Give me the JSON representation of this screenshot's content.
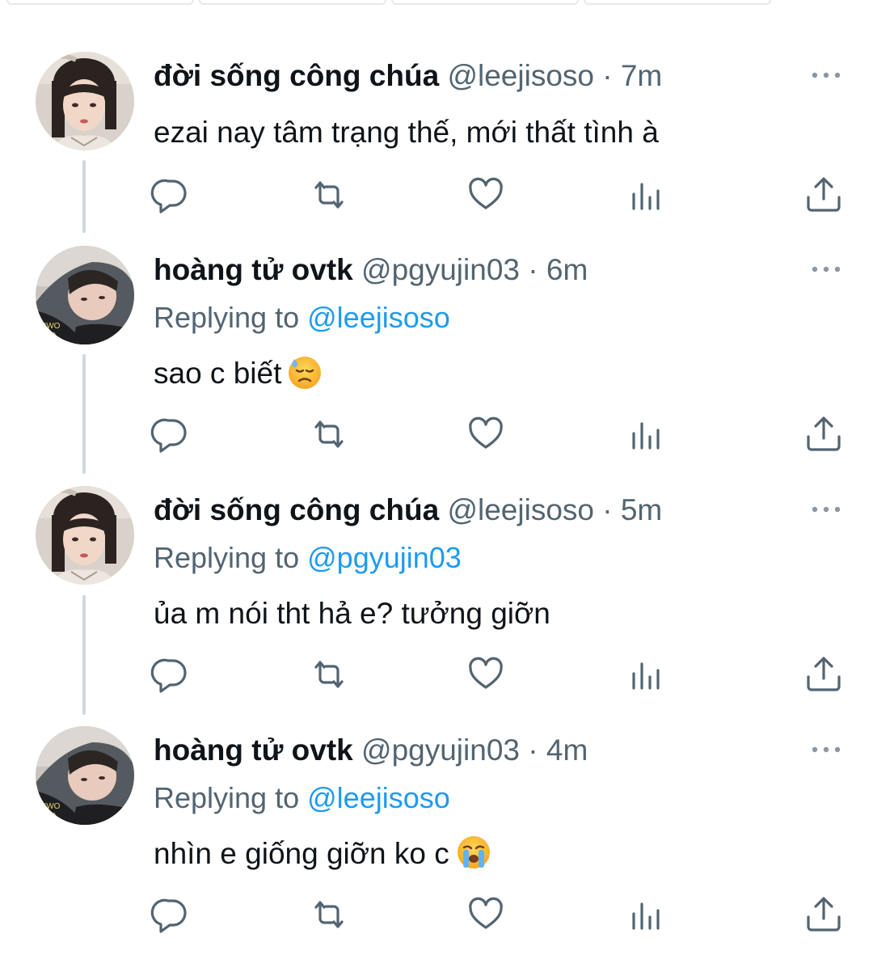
{
  "tweets": [
    {
      "name": "đời sống công chúa",
      "handle": "@leejisoso",
      "separator": "·",
      "time": "7m",
      "replying_label": "",
      "replying_to": "",
      "text": "ezai nay tâm trạng thế, mới thất tình à",
      "emoji": ""
    },
    {
      "name": "hoàng tử ovtk",
      "handle": "@pgyujin03",
      "separator": "·",
      "time": "6m",
      "replying_label": "Replying to",
      "replying_to": "@leejisoso",
      "text": "sao c biết",
      "emoji": "sweat-sad-face"
    },
    {
      "name": "đời sống công chúa",
      "handle": "@leejisoso",
      "separator": "·",
      "time": "5m",
      "replying_label": "Replying to",
      "replying_to": "@pgyujin03",
      "text": "ủa m nói tht hả e? tưởng giỡn",
      "emoji": ""
    },
    {
      "name": "hoàng tử ovtk",
      "handle": "@pgyujin03",
      "separator": "·",
      "time": "4m",
      "replying_label": "Replying to",
      "replying_to": "@leejisoso",
      "text": "nhìn e giống giỡn ko c",
      "emoji": "loudly-crying-face"
    }
  ],
  "actions": [
    "reply-icon",
    "retweet-icon",
    "like-icon",
    "views-icon",
    "share-icon"
  ],
  "colors": {
    "text": "#0f1419",
    "secondary": "#536471",
    "link": "#1d9bf0",
    "thread_line": "#cfd9de",
    "icon": "#536471"
  }
}
